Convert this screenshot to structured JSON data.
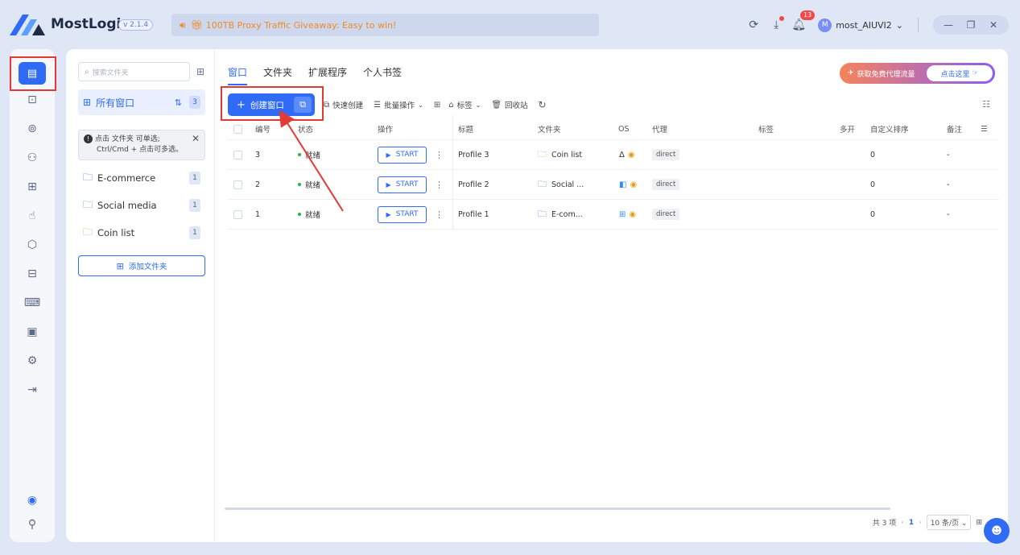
{
  "app": {
    "name": "MostLogin",
    "version": "v 2.1.4"
  },
  "banner": {
    "text": "100TB Proxy Traffic Giveaway: Easy to win!"
  },
  "titlebar": {
    "notification_count": "13",
    "user_initial": "M",
    "username": "most_AIUVI2"
  },
  "folder_panel": {
    "search_placeholder": "搜索文件夹",
    "all_windows_label": "所有窗口",
    "all_windows_count": "3",
    "tip_line1": "点击 文件夹 可单选;",
    "tip_line2": "Ctrl/Cmd + 点击可多选。",
    "folders": [
      {
        "name": "E-commerce",
        "count": "1"
      },
      {
        "name": "Social media",
        "count": "1"
      },
      {
        "name": "Coin list",
        "count": "1"
      }
    ],
    "add_folder_label": "添加文件夹"
  },
  "main": {
    "tabs": [
      "窗口",
      "文件夹",
      "扩展程序",
      "个人书签"
    ],
    "promo_text": "获取免费代理流量",
    "promo_button": "点击这里",
    "toolbar": {
      "create_label": "创建窗口",
      "quick_create": "快速创建",
      "batch_ops": "批量操作",
      "tags": "标签",
      "recycle": "回收站"
    },
    "table": {
      "headers": [
        "编号",
        "状态",
        "操作",
        "标题",
        "文件夹",
        "OS",
        "代理",
        "标签",
        "多开",
        "自定义排序",
        "备注"
      ],
      "rows": [
        {
          "id": "3",
          "status": "就绪",
          "action": "START",
          "title": "Profile 3",
          "folder": "Coin list",
          "proxy": "direct",
          "multi": "",
          "sort": "0",
          "note": "-"
        },
        {
          "id": "2",
          "status": "就绪",
          "action": "START",
          "title": "Profile 2",
          "folder": "Social ...",
          "proxy": "direct",
          "multi": "",
          "sort": "0",
          "note": "-"
        },
        {
          "id": "1",
          "status": "就绪",
          "action": "START",
          "title": "Profile 1",
          "folder": "E-com...",
          "proxy": "direct",
          "multi": "",
          "sort": "0",
          "note": "-"
        }
      ]
    },
    "pagination": {
      "total": "共 3 项",
      "current": "1",
      "page_size": "10 条/页"
    }
  },
  "colors": {
    "accent": "#2f6bf5",
    "highlight": "#e53935",
    "banner_text": "#f08a24"
  }
}
